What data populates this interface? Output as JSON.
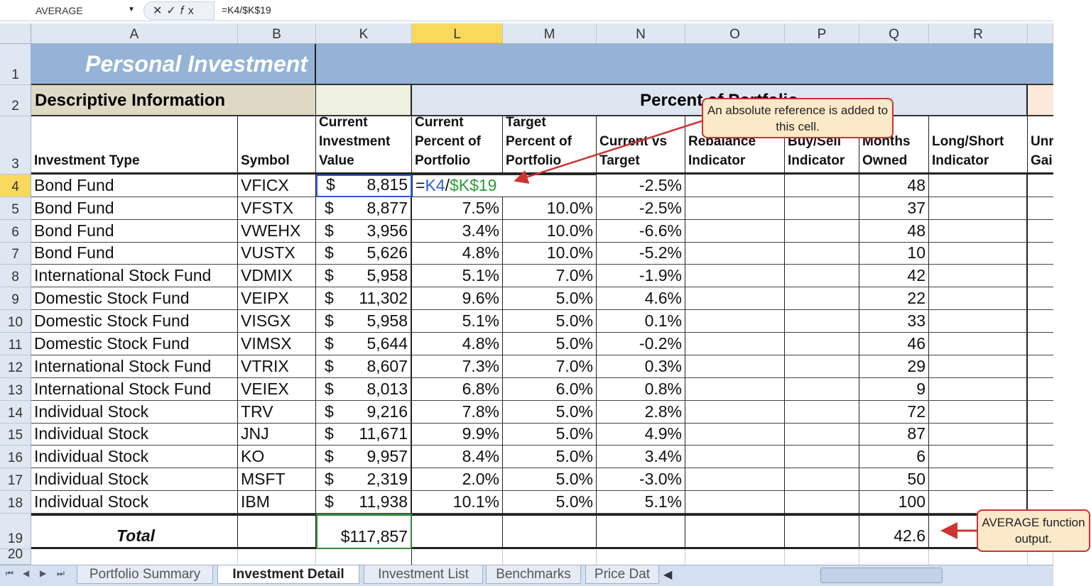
{
  "formula_bar": {
    "name_box": "AVERAGE",
    "buttons": "✕✓𝑓x",
    "formula": "=K4/$K$19"
  },
  "columns": [
    "A",
    "B",
    "K",
    "L",
    "M",
    "N",
    "O",
    "P",
    "Q",
    "R",
    ""
  ],
  "selected_column": "L",
  "row_numbers": [
    "1",
    "2",
    "3",
    "4",
    "5",
    "6",
    "7",
    "8",
    "9",
    "10",
    "11",
    "12",
    "13",
    "14",
    "15",
    "16",
    "17",
    "18",
    "19",
    "20"
  ],
  "title": "Personal Investment",
  "section_descriptive": "Descriptive Information",
  "section_percent": "Percent of Portfolio",
  "headers": [
    "Investment Type",
    "Symbol",
    "Current Investment Value",
    "Current Percent of Portfolio",
    "Target Percent of Portfolio",
    "Current vs Target",
    "Rebalance Indicator",
    "Buy/Sell Indicator",
    "Months Owned",
    "Long/Short Indicator",
    "Unr Gai"
  ],
  "editing_cell": {
    "eq": "=",
    "ref1": "K4",
    "slash": "/",
    "ref2": "$K$19",
    "ref1_color": "#2a5bd7",
    "ref2_color": "#2e9a3a"
  },
  "rows": [
    {
      "type": "Bond Fund",
      "symbol": "VFICX",
      "value": "8,815",
      "current": "",
      "target": "",
      "diff": "-2.5%",
      "months": "48"
    },
    {
      "type": "Bond Fund",
      "symbol": "VFSTX",
      "value": "8,877",
      "current": "7.5%",
      "target": "10.0%",
      "diff": "-2.5%",
      "months": "37"
    },
    {
      "type": "Bond Fund",
      "symbol": "VWEHX",
      "value": "3,956",
      "current": "3.4%",
      "target": "10.0%",
      "diff": "-6.6%",
      "months": "48"
    },
    {
      "type": "Bond Fund",
      "symbol": "VUSTX",
      "value": "5,626",
      "current": "4.8%",
      "target": "10.0%",
      "diff": "-5.2%",
      "months": "10"
    },
    {
      "type": "International Stock Fund",
      "symbol": "VDMIX",
      "value": "5,958",
      "current": "5.1%",
      "target": "7.0%",
      "diff": "-1.9%",
      "months": "42"
    },
    {
      "type": "Domestic Stock Fund",
      "symbol": "VEIPX",
      "value": "11,302",
      "current": "9.6%",
      "target": "5.0%",
      "diff": "4.6%",
      "months": "22"
    },
    {
      "type": "Domestic Stock Fund",
      "symbol": "VISGX",
      "value": "5,958",
      "current": "5.1%",
      "target": "5.0%",
      "diff": "0.1%",
      "months": "33"
    },
    {
      "type": "Domestic Stock Fund",
      "symbol": "VIMSX",
      "value": "5,644",
      "current": "4.8%",
      "target": "5.0%",
      "diff": "-0.2%",
      "months": "46"
    },
    {
      "type": "International Stock Fund",
      "symbol": "VTRIX",
      "value": "8,607",
      "current": "7.3%",
      "target": "7.0%",
      "diff": "0.3%",
      "months": "29"
    },
    {
      "type": "International Stock Fund",
      "symbol": "VEIEX",
      "value": "8,013",
      "current": "6.8%",
      "target": "6.0%",
      "diff": "0.8%",
      "months": "9"
    },
    {
      "type": "Individual Stock",
      "symbol": "TRV",
      "value": "9,216",
      "current": "7.8%",
      "target": "5.0%",
      "diff": "2.8%",
      "months": "72"
    },
    {
      "type": "Individual Stock",
      "symbol": "JNJ",
      "value": "11,671",
      "current": "9.9%",
      "target": "5.0%",
      "diff": "4.9%",
      "months": "87"
    },
    {
      "type": "Individual Stock",
      "symbol": "KO",
      "value": "9,957",
      "current": "8.4%",
      "target": "5.0%",
      "diff": "3.4%",
      "months": "6"
    },
    {
      "type": "Individual Stock",
      "symbol": "MSFT",
      "value": "2,319",
      "current": "2.0%",
      "target": "5.0%",
      "diff": "-3.0%",
      "months": "50"
    },
    {
      "type": "Individual Stock",
      "symbol": "IBM",
      "value": "11,938",
      "current": "10.1%",
      "target": "5.0%",
      "diff": "5.1%",
      "months": "100"
    }
  ],
  "currency_symbol": "$",
  "total": {
    "label": "Total",
    "value": "$117,857",
    "months_avg": "42.6"
  },
  "callouts": {
    "absolute_ref": "An absolute reference is added to this cell.",
    "average": "AVERAGE function output."
  },
  "sheet_tabs": [
    "Portfolio Summary",
    "Investment Detail",
    "Investment List",
    "Benchmarks",
    "Price Dat"
  ],
  "active_tab": "Investment Detail",
  "nav_arrows": [
    "⏮",
    "◀",
    "▶",
    "⏭"
  ],
  "colors": {
    "title_band": "#95b3d7",
    "descriptive_band": "#ddd9c4",
    "percent_band": "#dce6f1",
    "accent_red": "#cc3434",
    "callout_fill": "#fbe9c9"
  }
}
